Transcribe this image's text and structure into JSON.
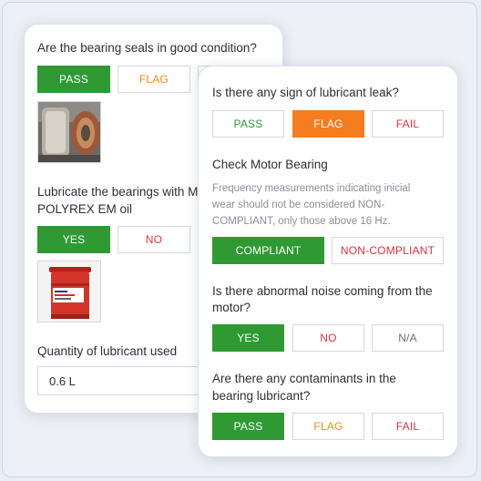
{
  "back_card": {
    "q1": "Are the bearing seals in good condition?",
    "q1_options": [
      "PASS",
      "FLAG",
      ""
    ],
    "q1_image": "bearing-photo",
    "q2_line1": "Lubricate the bearings with M",
    "q2_line2": "POLYREX EM oil",
    "q2_options": [
      "YES",
      "NO",
      ""
    ],
    "q2_image": "grease-bucket-photo",
    "q2_image_text": "Mobil Grease",
    "q3": "Quantity of lubricant used",
    "q3_value": "0.6 L"
  },
  "front_card": {
    "q1": "Is there any sign of lubricant leak?",
    "q1_options": [
      "PASS",
      "FLAG",
      "FAIL"
    ],
    "q2": "Check Motor Bearing",
    "q2_note_lines": [
      "Frequency measurements indicating inicial",
      "wear should not be considered NON-",
      "COMPLIANT, only those above 16 Hz."
    ],
    "q2_options": [
      "COMPLIANT",
      "NON-COMPLIANT"
    ],
    "q3_lines": [
      "Is there abnormal noise coming from the",
      "motor?"
    ],
    "q3_options": [
      "YES",
      "NO",
      "N/A"
    ],
    "q4_lines": [
      "Are there any contaminants in the",
      "bearing lubricant?"
    ],
    "q4_options": [
      "PASS",
      "FLAG",
      "FAIL"
    ]
  },
  "colors": {
    "selected_green": "#2f9a34",
    "selected_orange": "#f57c1f",
    "fail_red": "#d9333a"
  }
}
